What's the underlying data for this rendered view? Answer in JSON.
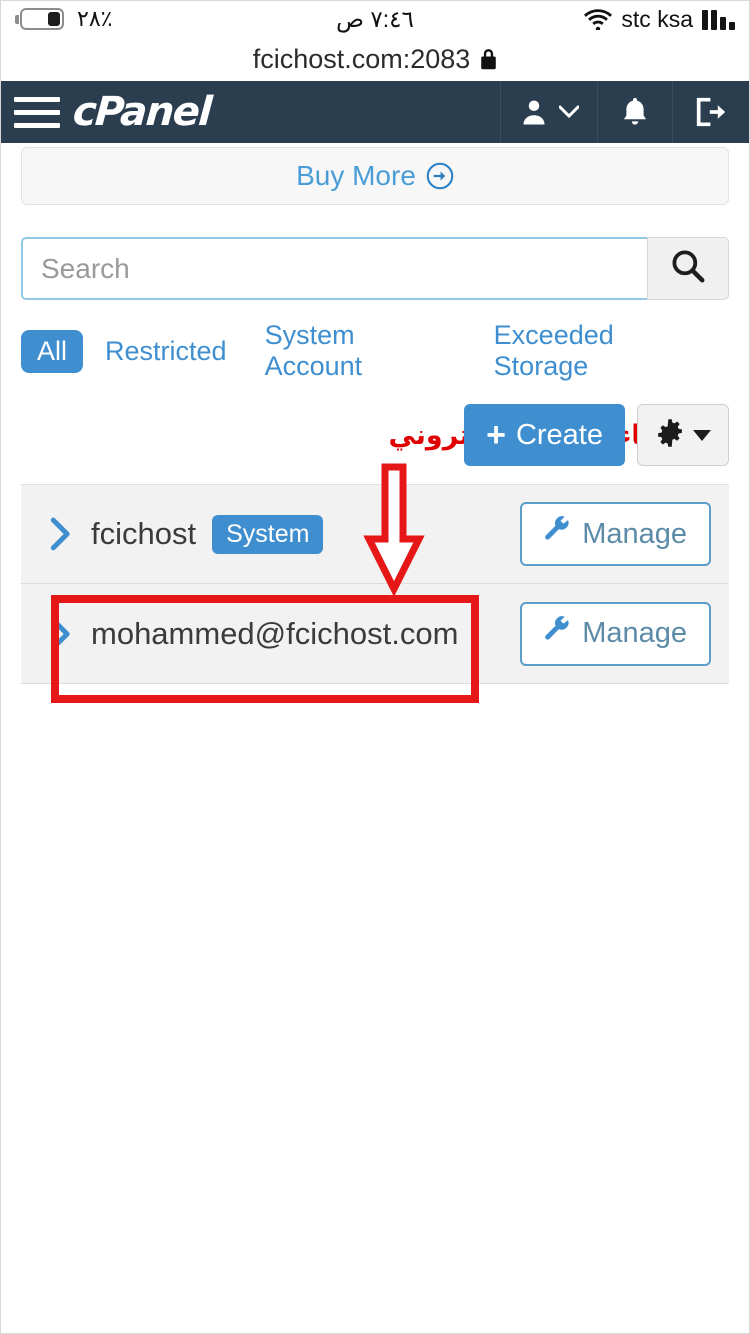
{
  "status_bar": {
    "battery_percent": "٪٢٨",
    "time": "٧:٤٦ ص",
    "carrier": "stc ksa",
    "wifi_icon": "wifi-icon",
    "signal_icon": "signal-bars-icon",
    "battery_icon": "battery-icon"
  },
  "browser": {
    "url": "fcichost.com:2083",
    "lock_icon": "lock-icon"
  },
  "navbar": {
    "menu_icon": "hamburger-menu-icon",
    "logo_text": "cPanel",
    "user_icon": "user-icon",
    "user_caret_icon": "chevron-down-icon",
    "notifications_icon": "bell-icon",
    "logout_icon": "logout-icon",
    "background_color": "#2b3e50"
  },
  "buy_panel": {
    "label": "Buy More",
    "icon": "arrow-circle-right-icon"
  },
  "search": {
    "placeholder": "Search",
    "value": "",
    "button_icon": "search-icon"
  },
  "filters": {
    "active": "All",
    "items": [
      {
        "label": "All",
        "active": true
      },
      {
        "label": "Restricted",
        "active": false
      },
      {
        "label": "System Account",
        "active": false
      },
      {
        "label": "Exceeded Storage",
        "active": false
      }
    ]
  },
  "actions": {
    "create_label": "Create",
    "create_plus": "+",
    "gear_icon": "gear-icon",
    "gear_caret_icon": "caret-down-icon"
  },
  "annotations": {
    "arabic_note": "تم إنشاء البريد الإلكتروني",
    "color": "#e51717",
    "arrow_icon": "down-arrow-annotation",
    "highlight_box": "red-highlight-rectangle"
  },
  "accounts": [
    {
      "name": "fcichost",
      "badge": "System",
      "has_badge": true,
      "chevron_icon": "chevron-right-icon",
      "manage_label": "Manage",
      "manage_icon": "wrench-icon",
      "highlighted": false
    },
    {
      "name": "mohammed@fcichost.com",
      "badge": "",
      "has_badge": false,
      "chevron_icon": "chevron-right-icon",
      "manage_label": "Manage",
      "manage_icon": "wrench-icon",
      "highlighted": true
    }
  ],
  "colors": {
    "accent_blue": "#3f8fd0",
    "navbar_dark": "#2b3e50",
    "annotation_red": "#e51717",
    "row_bg": "#f2f2f2"
  }
}
